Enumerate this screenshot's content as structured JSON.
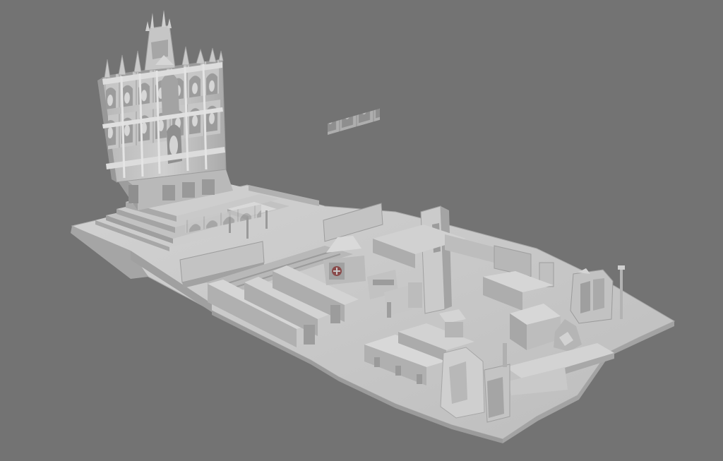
{
  "scene": {
    "background_color": "#737373",
    "model_base_color": "#c4c4c4",
    "shadow_color": "#8e8e8e",
    "highlight_color": "#dedede",
    "objects": [
      "altarpiece",
      "altar-platform",
      "altar-steps",
      "altar-table",
      "choir-screen-left",
      "choir-screen-right",
      "pulpit",
      "column",
      "pews",
      "chairs",
      "side-altar",
      "staff",
      "rubble"
    ]
  }
}
